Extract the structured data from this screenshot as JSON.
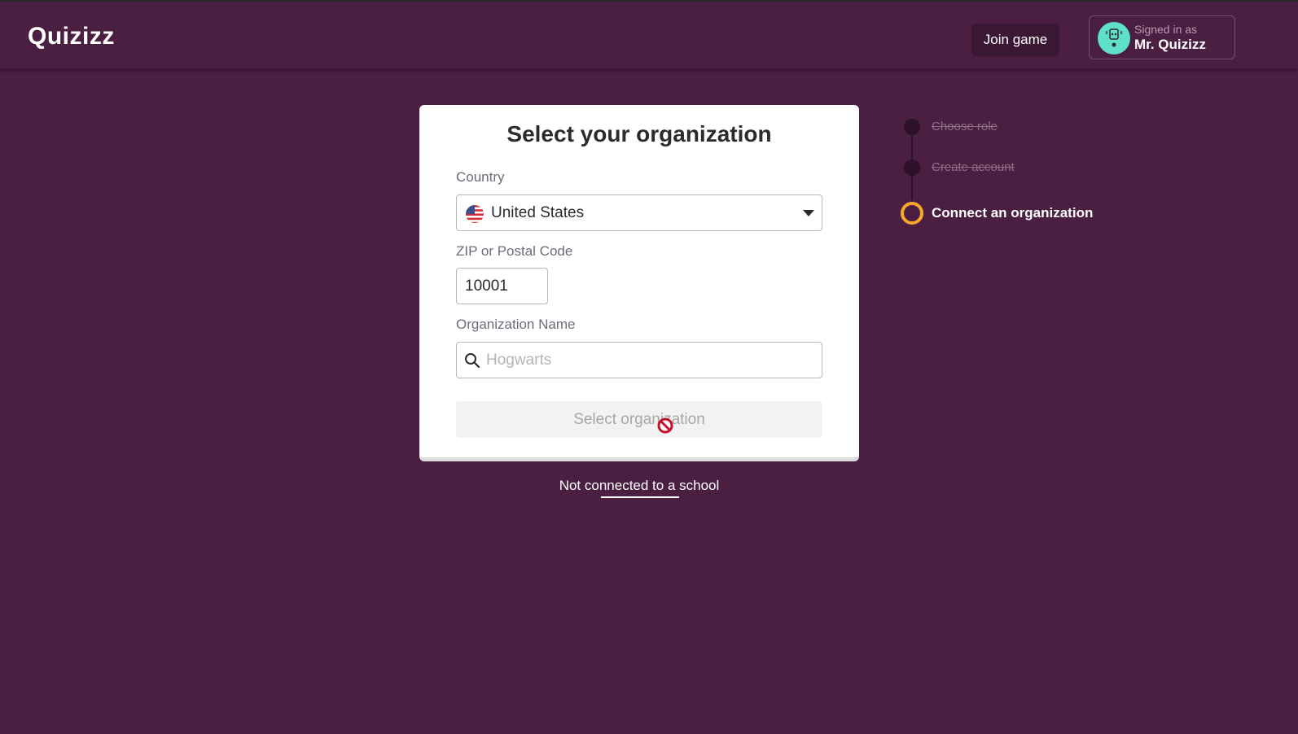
{
  "header": {
    "logo_text": "Quizizz",
    "join_game_label": "Join game",
    "signed_in_label": "Signed in as",
    "user_name": "Mr. Quizizz"
  },
  "form": {
    "title": "Select your organization",
    "country_label": "Country",
    "country_value": "United States",
    "zip_label": "ZIP or Postal Code",
    "zip_value": "10001",
    "org_label": "Organization Name",
    "org_placeholder": "Hogwarts",
    "submit_label": "Select organization"
  },
  "not_connected_link": "Not connected to a school",
  "steps": [
    {
      "label": "Choose role",
      "state": "done"
    },
    {
      "label": "Create account",
      "state": "done"
    },
    {
      "label": "Connect an organization",
      "state": "active"
    }
  ],
  "colors": {
    "background": "#4a1f42",
    "active_step": "#f4a92a",
    "avatar": "#5fe0c9"
  },
  "icons": [
    "search-icon",
    "chevron-down-icon",
    "us-flag-icon",
    "not-allowed-cursor-icon"
  ]
}
